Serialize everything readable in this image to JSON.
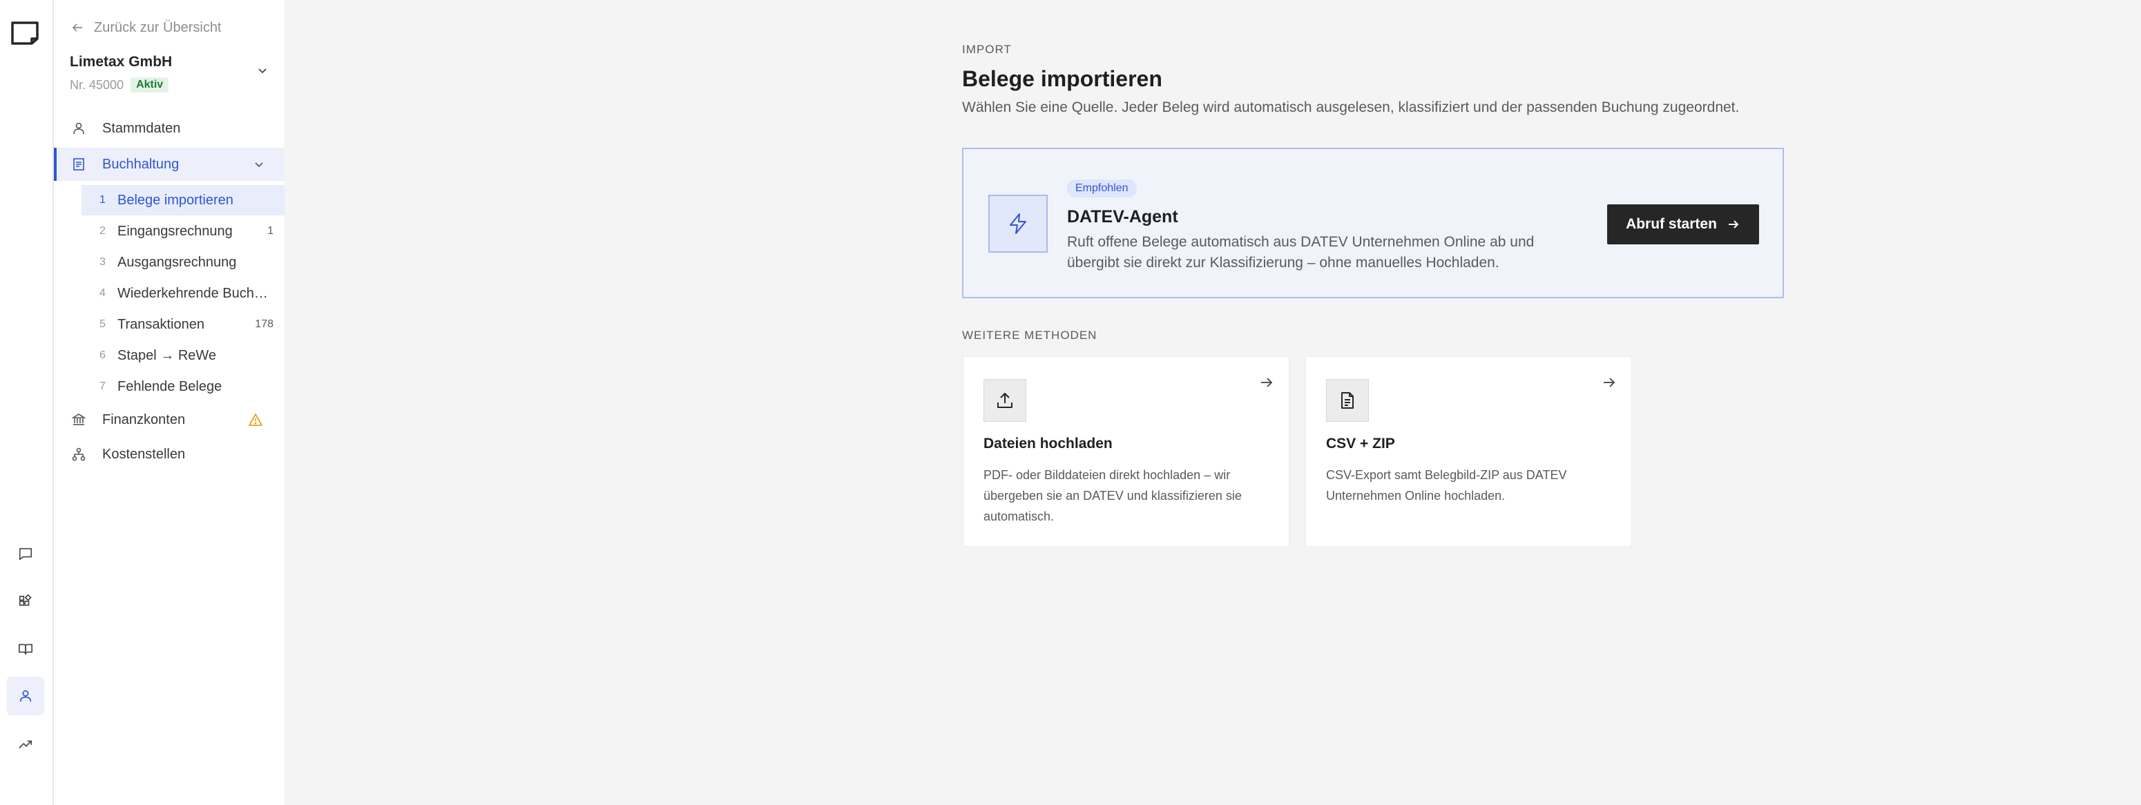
{
  "sidebar": {
    "back_label": "Zurück zur Übersicht",
    "company": {
      "name": "Limetax GmbH",
      "number": "Nr. 45000",
      "status": "Aktiv"
    },
    "nav": {
      "stammdaten": "Stammdaten",
      "buchhaltung": "Buchhaltung",
      "finanzkonten": "Finanzkonten",
      "kostenstellen": "Kostenstellen"
    },
    "sub_items": [
      {
        "num": "1",
        "label": "Belege importieren",
        "count": ""
      },
      {
        "num": "2",
        "label": "Eingangsrechnung",
        "count": "1"
      },
      {
        "num": "3",
        "label": "Ausgangsrechnung",
        "count": ""
      },
      {
        "num": "4",
        "label": "Wiederkehrende Buchungen",
        "count": ""
      },
      {
        "num": "5",
        "label": "Transaktionen",
        "count": "178"
      },
      {
        "num": "6",
        "label": "Stapel → ReWe",
        "count": ""
      },
      {
        "num": "7",
        "label": "Fehlende Belege",
        "count": ""
      }
    ]
  },
  "rail": {
    "icons": [
      "logo-icon",
      "chat-icon",
      "apps-icon",
      "book-icon",
      "user-icon",
      "trend-icon"
    ],
    "active": "user-icon"
  },
  "main": {
    "eyebrow": "IMPORT",
    "title": "Belege importieren",
    "description": "Wählen Sie eine Quelle. Jeder Beleg wird automatisch ausgelesen, klassifiziert und der passenden Buchung zugeordnet.",
    "featured": {
      "badge": "Empfohlen",
      "title": "DATEV-Agent",
      "description": "Ruft offene Belege automatisch aus DATEV Unternehmen Online ab und übergibt sie direkt zur Klassifizierung – ohne manuelles Hochladen.",
      "button": "Abruf starten"
    },
    "section_label": "WEITERE METHODEN",
    "methods": [
      {
        "title": "Dateien hochladen",
        "description": "PDF- oder Bilddateien direkt hochladen – wir übergeben sie an DATEV und klassifizieren sie automatisch."
      },
      {
        "title": "CSV + ZIP",
        "description": "CSV-Export samt Belegbild-ZIP aus DATEV Unternehmen Online hochladen."
      }
    ]
  },
  "colors": {
    "accent": "#2f54d4",
    "warning": "#e8a317",
    "status_green": "#1e7a34",
    "button_dark": "#262626"
  }
}
